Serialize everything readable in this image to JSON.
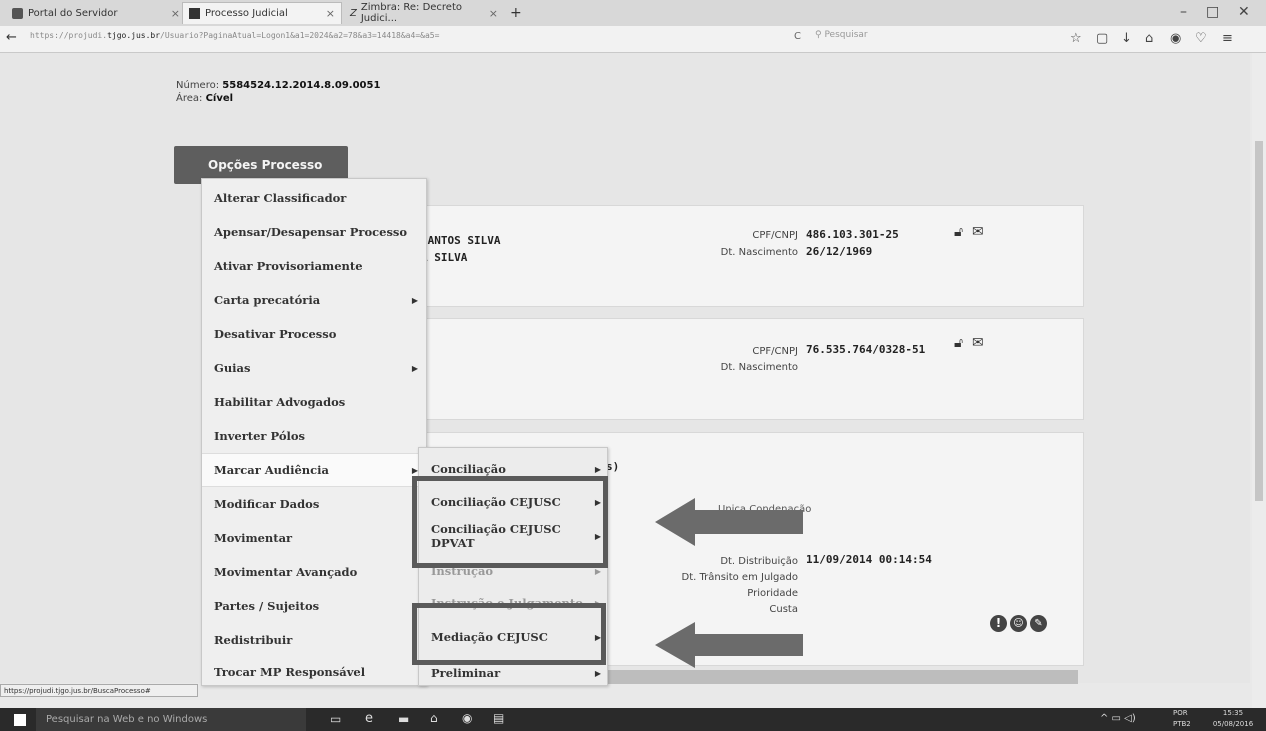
{
  "browser": {
    "tabs": [
      {
        "label": "Portal do Servidor",
        "close": "×"
      },
      {
        "label": "Processo Judicial",
        "close": "×"
      },
      {
        "label": "Zimbra: Re: Decreto Judici...",
        "close": "×"
      }
    ],
    "new_tab": "+",
    "url_prefix": "https://projudi.",
    "url_host": "tjgo.jus.br",
    "url_rest": "/Usuario?PaginaAtual=Logon1&a1=2024&a2=78&a3=14418&a4=&a5=",
    "reload": "C",
    "search_placeholder": "Pesquisar",
    "window_controls": {
      "min": "–",
      "max": "□",
      "close": "✕"
    }
  },
  "processo": {
    "numero_label": "Número:",
    "numero": "5584524.12.2014.8.09.0051",
    "area_label": "Área:",
    "area": "Cível"
  },
  "opcoes_label": "Opções Processo",
  "party1": {
    "name_line1": "SANTOS SILVA",
    "name_line2": "A SILVA",
    "cpf_label": "CPF/CNPJ",
    "cpf": "486.103.301-25",
    "nasc_label": "Dt. Nascimento",
    "nasc": "26/12/1969"
  },
  "party2": {
    "cpf_label": "CPF/CNPJ",
    "cpf": "76.535.764/0328-51",
    "nasc_label": "Dt. Nascimento"
  },
  "section3": {
    "partial": "s)",
    "partial2": "Unica Condenação",
    "dist_label": "Dt. Distribuição",
    "dist": "11/09/2014 00:14:54",
    "transito_label": "Dt. Trânsito em Julgado",
    "prioridade_label": "Prioridade",
    "custa_label": "Custa"
  },
  "menu": [
    {
      "label": "Alterar Classificador"
    },
    {
      "label": "Apensar/Desapensar Processo"
    },
    {
      "label": "Ativar Provisoriamente"
    },
    {
      "label": "Carta precatória",
      "arrow": "▶"
    },
    {
      "label": "Desativar Processo"
    },
    {
      "label": "Guias",
      "arrow": "▶"
    },
    {
      "label": "Habilitar Advogados"
    },
    {
      "label": "Inverter Pólos"
    },
    {
      "label": "Marcar Audiência",
      "arrow": "▶"
    },
    {
      "label": "Modificar Dados"
    },
    {
      "label": "Movimentar"
    },
    {
      "label": "Movimentar Avançado"
    },
    {
      "label": "Partes / Sujeitos"
    },
    {
      "label": "Redistribuir"
    },
    {
      "label": "Trocar MP Responsável"
    }
  ],
  "submenu": [
    {
      "label": "Conciliação",
      "arrow": "▶"
    },
    {
      "label": "Conciliação CEJUSC",
      "arrow": "▶"
    },
    {
      "label": "Conciliação CEJUSC DPVAT",
      "arrow": "▶"
    },
    {
      "label": "Instrução",
      "arrow": "▶"
    },
    {
      "label": "Instrução e Julgamento",
      "arrow": "▶"
    },
    {
      "label": "Mediação CEJUSC",
      "arrow": "▶"
    },
    {
      "label": "Preliminar",
      "arrow": "▶"
    }
  ],
  "statusbar": "https://projudi.tjgo.jus.br/BuscaProcesso#",
  "taskbar": {
    "search": "Pesquisar na Web e no Windows",
    "lang1": "POR",
    "lang2": "PTB2",
    "time": "15:35",
    "date": "05/08/2016"
  },
  "colors": {
    "arrow": "#6b6b6b",
    "box": "#5a5a5a",
    "button": "#5e5e5e"
  }
}
